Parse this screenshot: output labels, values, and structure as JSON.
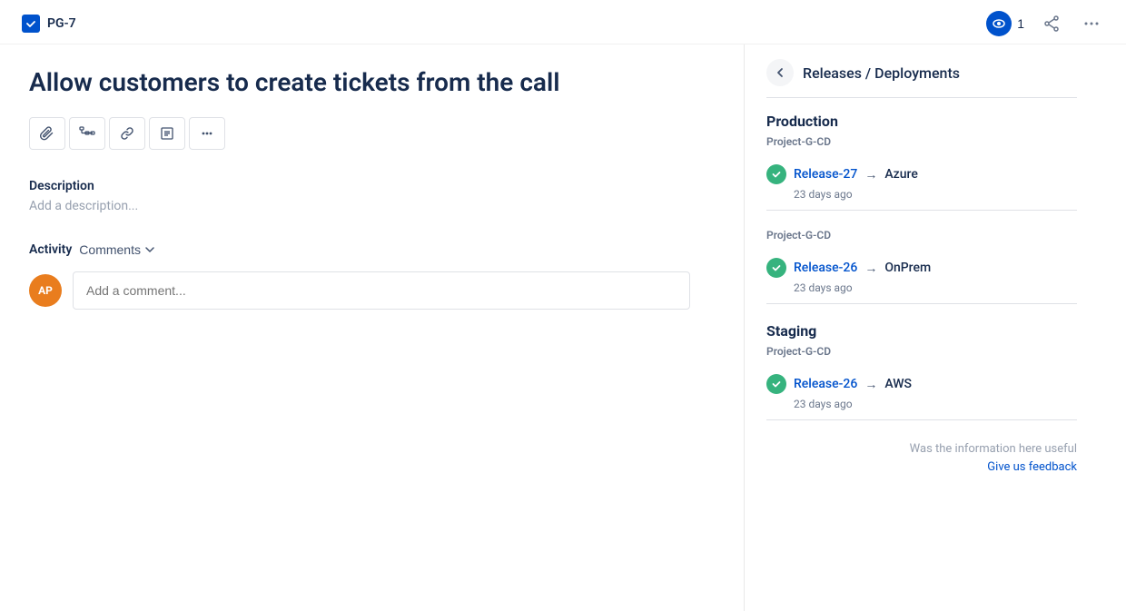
{
  "header": {
    "ticket_id": "PG-7",
    "watch_count": "1",
    "back_label": "←"
  },
  "issue": {
    "title": "Allow customers to create tickets from the call"
  },
  "toolbar": {
    "buttons": [
      {
        "name": "attach-icon",
        "symbol": "📎"
      },
      {
        "name": "diagram-icon",
        "symbol": "⎇"
      },
      {
        "name": "link-icon",
        "symbol": "🔗"
      },
      {
        "name": "checklist-icon",
        "symbol": "☰"
      },
      {
        "name": "more-icon",
        "symbol": "···"
      }
    ]
  },
  "description": {
    "label": "Description",
    "placeholder": "Add a description..."
  },
  "activity": {
    "label": "Activity",
    "filter_label": "Comments",
    "comment_placeholder": "Add a comment...",
    "avatar_initials": "AP"
  },
  "releases_panel": {
    "title": "Releases / Deployments",
    "environments": [
      {
        "name": "Production",
        "project": "Project-G-CD",
        "releases": [
          {
            "release": "Release-27",
            "target": "Azure",
            "time": "23 days ago"
          }
        ]
      },
      {
        "name": "",
        "project": "Project-G-CD",
        "releases": [
          {
            "release": "Release-26",
            "target": "OnPrem",
            "time": "23 days ago"
          }
        ]
      },
      {
        "name": "Staging",
        "project": "Project-G-CD",
        "releases": [
          {
            "release": "Release-26",
            "target": "AWS",
            "time": "23 days ago"
          }
        ]
      }
    ],
    "feedback_text": "Was the information here useful",
    "feedback_link": "Give us feedback"
  }
}
